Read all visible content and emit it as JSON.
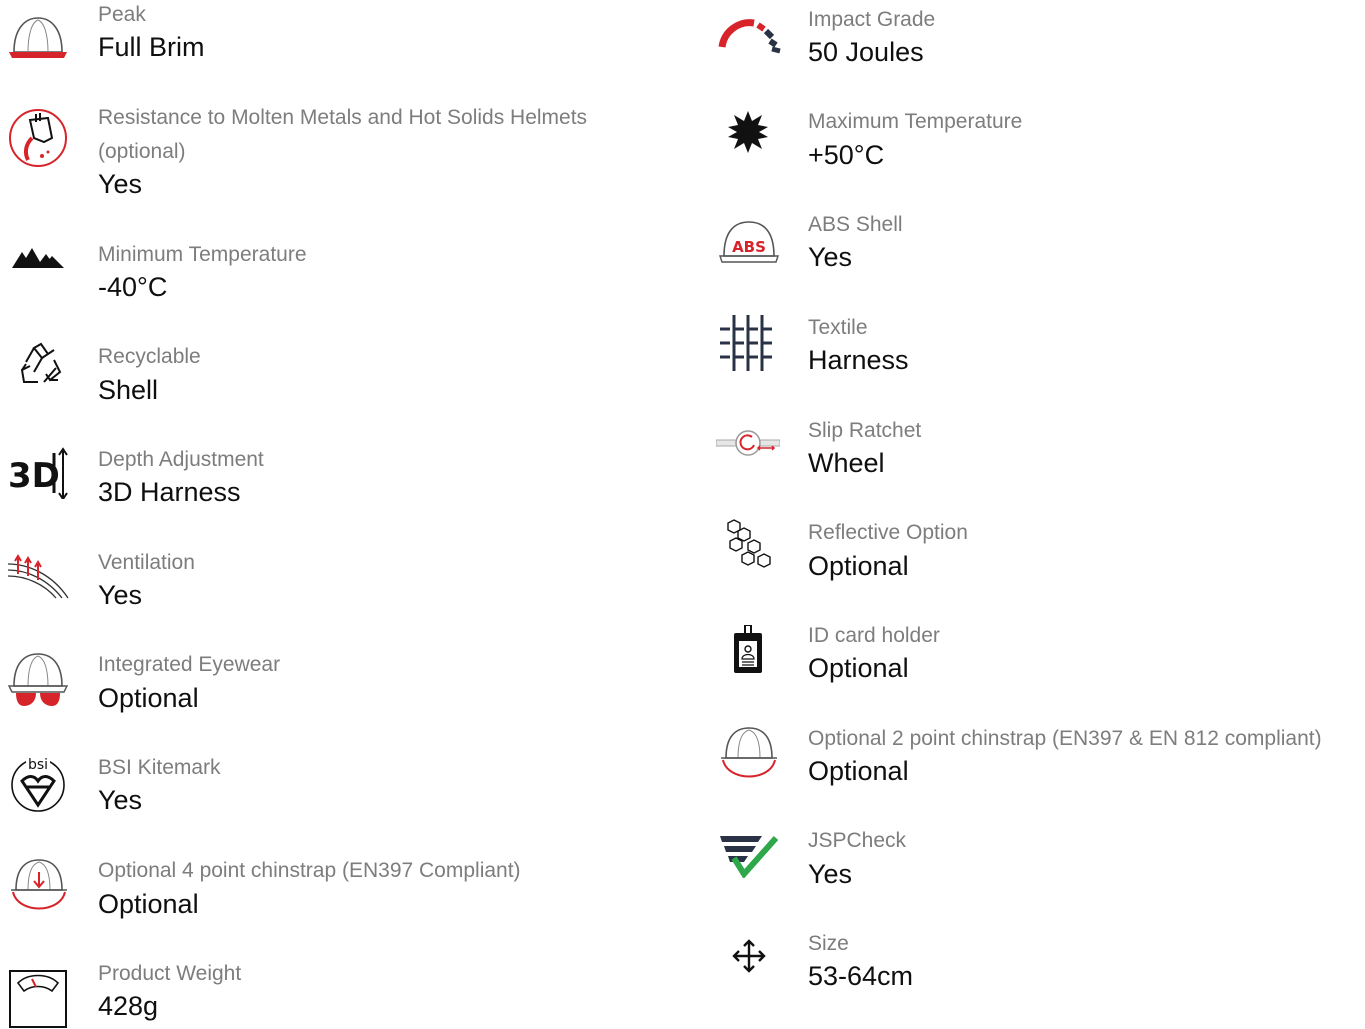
{
  "features_left": [
    {
      "icon": "helmet-peak-icon",
      "label": "Peak",
      "value": "Full Brim"
    },
    {
      "icon": "molten-metal-icon",
      "label": "Resistance to Molten Metals and Hot Solids Helmets (optional)",
      "value": "Yes"
    },
    {
      "icon": "mountain-icon",
      "label": "Minimum Temperature",
      "value": "-40°C"
    },
    {
      "icon": "recycle-icon",
      "label": "Recyclable",
      "value": "Shell"
    },
    {
      "icon": "3d-adjust-icon",
      "label": "Depth Adjustment",
      "value": "3D Harness"
    },
    {
      "icon": "ventilation-icon",
      "label": "Ventilation",
      "value": "Yes"
    },
    {
      "icon": "helmet-eyewear-icon",
      "label": "Integrated Eyewear",
      "value": "Optional"
    },
    {
      "icon": "bsi-kitemark-icon",
      "label": "BSI Kitemark",
      "value": "Yes"
    },
    {
      "icon": "helmet-4pt-chinstrap-icon",
      "label": "Optional 4 point chinstrap (EN397 Compliant)",
      "value": "Optional"
    },
    {
      "icon": "weight-scale-icon",
      "label": "Product Weight",
      "value": "428g"
    }
  ],
  "features_right": [
    {
      "icon": "impact-gauge-icon",
      "label": "Impact Grade",
      "value": "50 Joules"
    },
    {
      "icon": "sun-icon",
      "label": "Maximum Temperature",
      "value": "+50°C"
    },
    {
      "icon": "abs-helmet-icon",
      "label": "ABS Shell",
      "value": "Yes",
      "icon_text": "ABS"
    },
    {
      "icon": "textile-icon",
      "label": "Textile",
      "value": "Harness"
    },
    {
      "icon": "slip-ratchet-icon",
      "label": "Slip Ratchet",
      "value": "Wheel"
    },
    {
      "icon": "reflective-hexagon-icon",
      "label": "Reflective Option",
      "value": "Optional"
    },
    {
      "icon": "id-card-holder-icon",
      "label": "ID card holder",
      "value": "Optional"
    },
    {
      "icon": "helmet-2pt-chinstrap-icon",
      "label": "Optional 2 point chinstrap (EN397 & EN 812 compliant)",
      "value": "Optional"
    },
    {
      "icon": "jspcheck-icon",
      "label": "JSPCheck",
      "value": "Yes"
    },
    {
      "icon": "size-arrows-icon",
      "label": "Size",
      "value": "53-64cm"
    }
  ],
  "colors": {
    "accent_red": "#d7242a",
    "dark": "#1b2230",
    "label_gray": "#7d7d7d",
    "check_green": "#2ea84a"
  }
}
